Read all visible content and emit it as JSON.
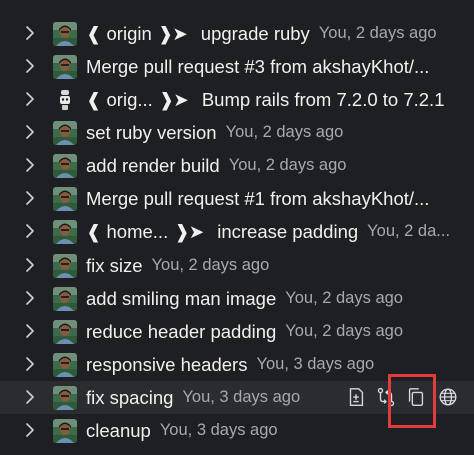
{
  "commits": [
    {
      "refs": [
        "origin"
      ],
      "message": "upgrade ruby",
      "meta": "You, 2 days ago",
      "avatar": "person"
    },
    {
      "refs": [],
      "message": "Merge pull request #3 from akshayKhot/...",
      "meta": "",
      "avatar": "person"
    },
    {
      "refs": [
        "orig..."
      ],
      "message": "Bump rails from 7.2.0 to 7.2.1",
      "meta": "",
      "avatar": "bot"
    },
    {
      "refs": [],
      "message": "set ruby version",
      "meta": "You, 2 days ago",
      "avatar": "person"
    },
    {
      "refs": [],
      "message": "add render build",
      "meta": "You, 2 days ago",
      "avatar": "person"
    },
    {
      "refs": [],
      "message": "Merge pull request #1 from akshayKhot/...",
      "meta": "",
      "avatar": "person"
    },
    {
      "refs": [
        "home..."
      ],
      "message": "increase padding",
      "meta": "You, 2 da...",
      "avatar": "person"
    },
    {
      "refs": [],
      "message": "fix size",
      "meta": "You, 2 days ago",
      "avatar": "person"
    },
    {
      "refs": [],
      "message": "add smiling man image",
      "meta": "You, 2 days ago",
      "avatar": "person"
    },
    {
      "refs": [],
      "message": "reduce header padding",
      "meta": "You, 2 days ago",
      "avatar": "person"
    },
    {
      "refs": [],
      "message": "responsive headers",
      "meta": "You, 3 days ago",
      "avatar": "person"
    },
    {
      "refs": [],
      "message": "fix spacing",
      "meta": "You, 3 days ago",
      "avatar": "person",
      "hovered": true
    },
    {
      "refs": [],
      "message": "cleanup",
      "meta": "You, 3 days ago",
      "avatar": "person"
    }
  ],
  "row_actions": [
    {
      "name": "open-changes-icon"
    },
    {
      "name": "compare-icon"
    },
    {
      "name": "copy-commit-id-icon"
    },
    {
      "name": "open-on-remote-icon"
    }
  ],
  "colors": {
    "background": "#1e1f22",
    "hover_background": "#2b2c30",
    "text": "#f0f0f0",
    "meta_text": "#a7a9ad",
    "highlight": "#e23b3b"
  }
}
